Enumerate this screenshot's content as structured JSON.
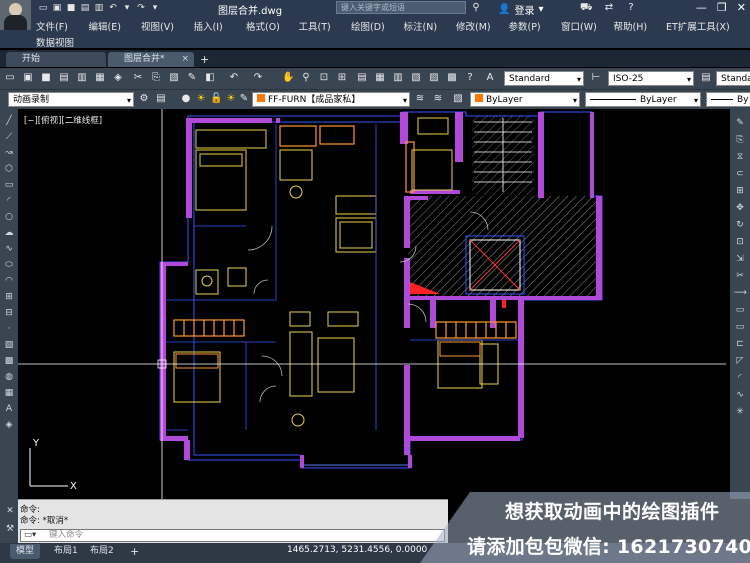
{
  "titlebar": {
    "doc_title": "图层合并.dwg",
    "search_placeholder": "键入关键字或短语",
    "login": "登录"
  },
  "menu": [
    "文件(F)",
    "编辑(E)",
    "视图(V)",
    "插入(I)",
    "格式(O)",
    "工具(T)",
    "绘图(D)",
    "标注(N)",
    "修改(M)",
    "参数(P)",
    "窗口(W)",
    "帮助(H)",
    "ET扩展工具(X)"
  ],
  "menu_row2": "数据视图",
  "tabs": [
    {
      "label": "开始"
    },
    {
      "label": "图层合并*"
    }
  ],
  "toolbar": {
    "text_style": "Standard",
    "dim_style": "ISO-25",
    "table_style": "Standa",
    "workspace": "动画录制",
    "layer": "FF-FURN【成品家私】",
    "color": "ByLayer",
    "linetype": "ByLayer",
    "lineweight": "By"
  },
  "view_label": "[−][俯视][二维线框]",
  "command": {
    "line1": "命令:",
    "line2": "命令: *取消*",
    "input_placeholder": "键入命令"
  },
  "status": {
    "tabs": [
      "模型",
      "布局1",
      "布局2"
    ],
    "coords": "1465.2713, 5231.4556, 0.0000"
  },
  "promo": {
    "line1": "想获取动画中的绘图插件",
    "line2": "请添加包包微信: 1621730740"
  },
  "colors": {
    "wall_magenta": "#cc44ff",
    "outline_blue": "#3355ff",
    "furniture_yellow": "#e8d24a",
    "kitchen_orange": "#ff9933",
    "hatch": "#888888"
  }
}
